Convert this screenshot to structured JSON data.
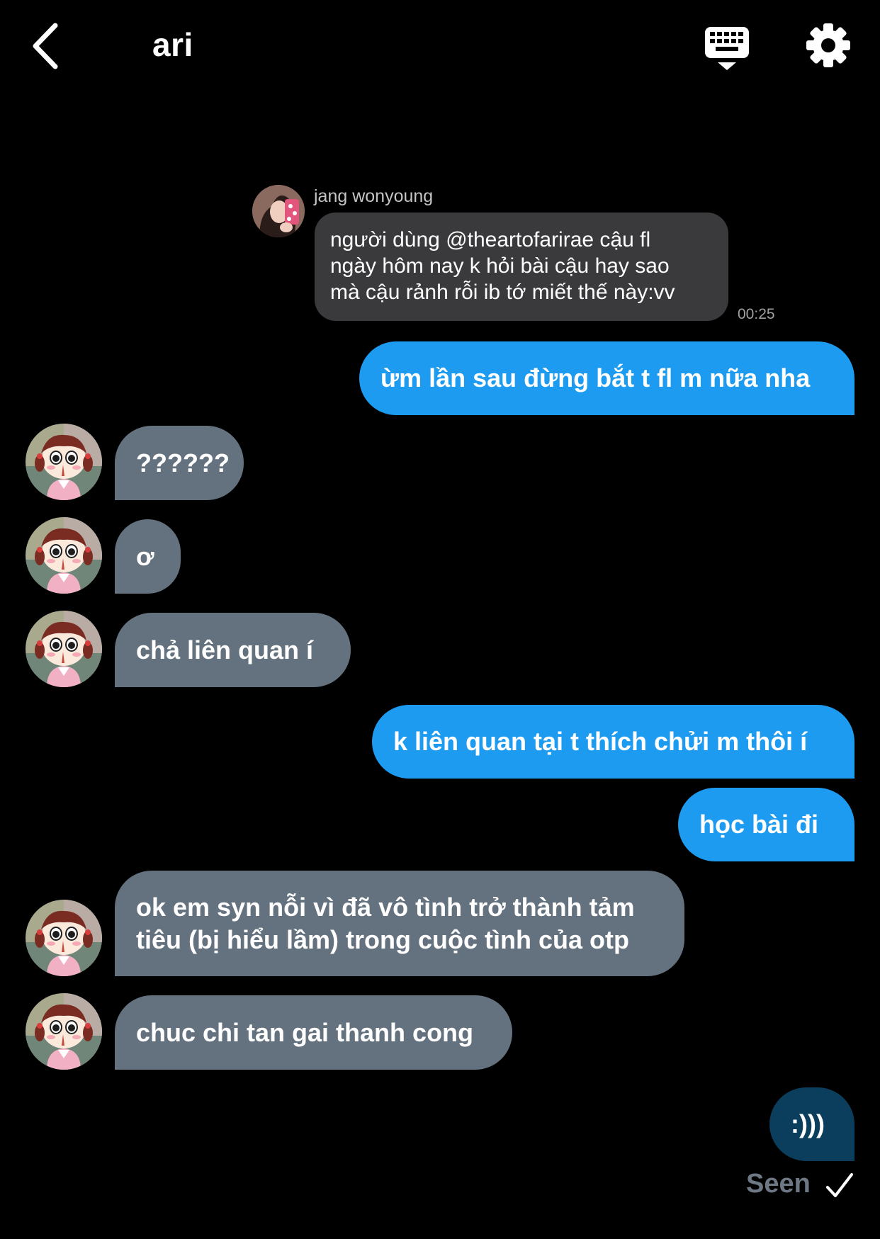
{
  "header": {
    "title": "ari",
    "icons": {
      "back": "chevron-left-icon",
      "keyboard": "keyboard-icon",
      "settings": "gear-icon"
    }
  },
  "reply": {
    "author": "jang wonyoung",
    "lines": [
      "người dùng @theartofarirae cậu fl",
      "ngày hôm nay k hỏi bài cậu hay sao",
      "mà cậu rảnh rỗi ib tớ miết thế này:vv"
    ],
    "time": "00:25"
  },
  "messages": [
    {
      "side": "sent",
      "lines": [
        "ừm lần sau đừng bắt t fl m nữa nha"
      ]
    },
    {
      "side": "received",
      "lines": [
        "??????"
      ]
    },
    {
      "side": "received",
      "lines": [
        "ơ"
      ]
    },
    {
      "side": "received",
      "lines": [
        "chả liên quan í"
      ]
    },
    {
      "side": "sent",
      "lines": [
        "k liên quan tại t thích chửi m thôi í"
      ]
    },
    {
      "side": "sent",
      "lines": [
        "học bài đi"
      ]
    },
    {
      "side": "received",
      "lines": [
        "ok em syn nỗi vì đã vô tình trở thành tảm",
        "tiêu (bị hiểu lầm) trong cuộc tình của otp"
      ]
    },
    {
      "side": "received",
      "lines": [
        "chuc chi tan gai thanh cong"
      ]
    },
    {
      "side": "sent",
      "lines": [
        ":)))"
      ]
    }
  ],
  "status": {
    "seen": "Seen",
    "check_icon": "checkmark-icon"
  },
  "colors": {
    "background": "#000000",
    "sent_bubble": "#1d9bf0",
    "received_bubble": "#64717e",
    "last_sent_bubble": "#0b3d5c",
    "reply_bubble": "#3a3a3c"
  }
}
